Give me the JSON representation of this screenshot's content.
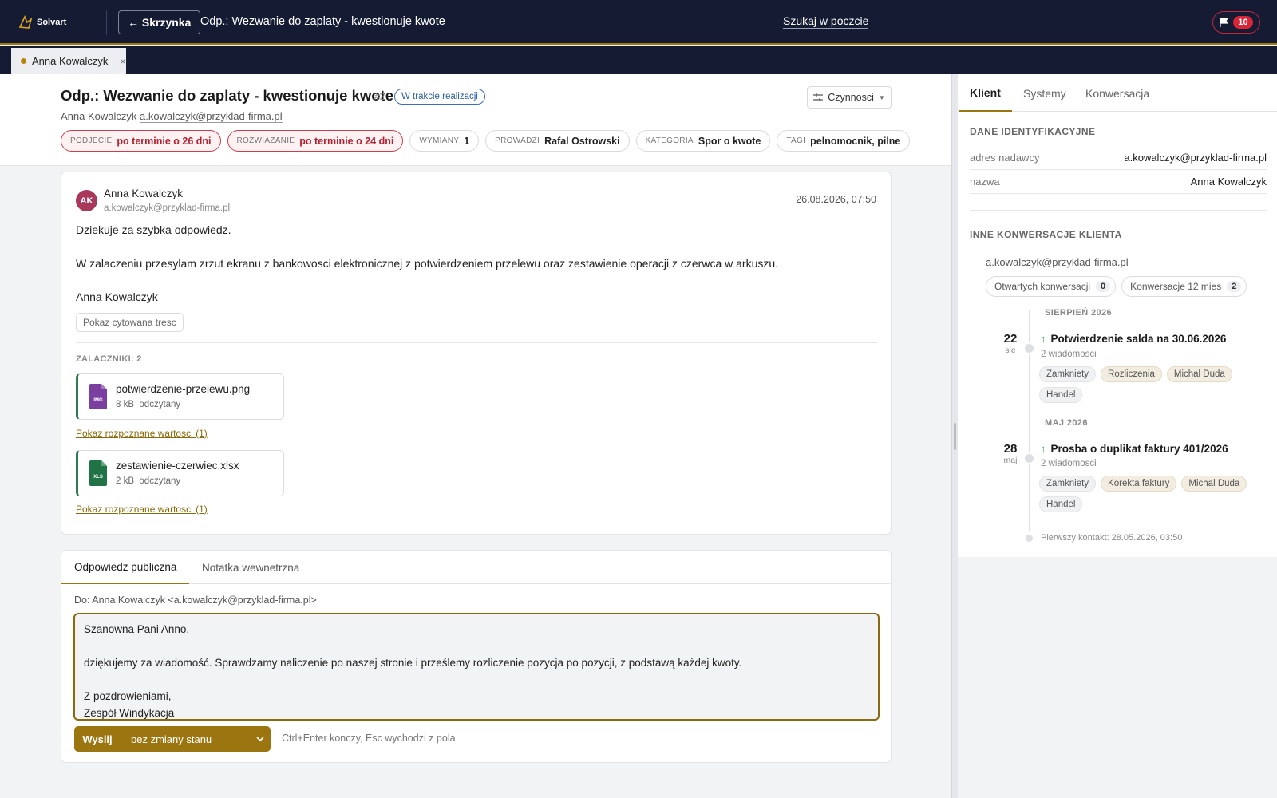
{
  "topbar": {
    "logo_text": "Solvart",
    "back_label": "← Skrzynka",
    "title": "Odp.: Wezwanie do zaplaty - kwestionuje kwote",
    "search_label": "Szukaj w poczcie",
    "flag_count": "10"
  },
  "tabs": {
    "open_tab_label": "Anna Kowalczyk",
    "close_glyph": "×"
  },
  "ticket": {
    "title": "Odp.: Wezwanie do zaplaty - kwestionuje kwote",
    "number": "#2",
    "status": "W trakcie realizacji",
    "actions_label": "Czynnosci",
    "sender_name": "Anna Kowalczyk",
    "sender_email": "a.kowalczyk@przyklad-firma.pl",
    "chips": [
      {
        "key": "PODJECIE",
        "value": "po terminie o 26 dni"
      },
      {
        "key": "ROZWIAZANIE",
        "value": "po terminie o 24 dni"
      },
      {
        "key": "WYMIANY",
        "value": "1"
      },
      {
        "key": "PROWADZI",
        "value": "Rafal Ostrowski"
      },
      {
        "key": "KATEGORIA",
        "value": "Spor o kwote"
      },
      {
        "key": "TAGI",
        "value": "pelnomocnik, pilne"
      }
    ]
  },
  "message": {
    "avatar_initials": "AK",
    "from_name": "Anna Kowalczyk",
    "from_email": "a.kowalczyk@przyklad-firma.pl",
    "date": "26.08.2026, 07:50",
    "body": [
      "Dziekuje za szybka odpowiedz.",
      "W zalaczeniu przesylam zrzut ekranu z bankowosci elektronicznej z potwierdzeniem przelewu oraz zestawienie operacji z czerwca w arkuszu.",
      "Anna Kowalczyk"
    ],
    "show_quote_label": "Pokaz cytowana tresc",
    "attachments_label": "ZALACZNIKI: 2",
    "attachments": [
      {
        "name": "potwierdzenie-przelewu.png",
        "size": "8 kB",
        "status": "odczytany",
        "icon_label": "IMG",
        "icon_color": "#7b3fa0"
      },
      {
        "name": "zestawienie-czerwiec.xlsx",
        "size": "2 kB",
        "status": "odczytany",
        "icon_label": "XLS",
        "icon_color": "#217346"
      }
    ],
    "recognized_link": "Pokaz rozpoznane wartosci (1)"
  },
  "reply": {
    "tab_public": "Odpowiedz publiczna",
    "tab_note": "Notatka wewnetrzna",
    "to_line": "Do: Anna Kowalczyk <a.kowalczyk@przyklad-firma.pl>",
    "text": "Szanowna Pani Anno,\n\ndziękujemy za wiadomość. Sprawdzamy naliczenie po naszej stronie i prześlemy rozliczenie pozycja po pozycji, z podstawą każdej kwoty.\n\nZ pozdrowieniami,\nZespół Windykacja",
    "send_label": "Wyslij",
    "state_label": "bez zmiany stanu",
    "hint": "Ctrl+Enter konczy, Esc wychodzi z pola"
  },
  "sidebar": {
    "tabs": [
      "Klient",
      "Systemy",
      "Konwersacja"
    ],
    "ident_title": "DANE IDENTYFIKACYJNE",
    "rows": [
      {
        "key": "adres nadawcy",
        "value": "a.kowalczyk@przyklad-firma.pl"
      },
      {
        "key": "nazwa",
        "value": "Anna Kowalczyk"
      }
    ],
    "other_title": "INNE KONWERSACJE KLIENTA",
    "client_email": "a.kowalczyk@przyklad-firma.pl",
    "open_label": "Otwartych konwersacji",
    "open_count": "0",
    "year_label": "Konwersacje 12 mies",
    "year_count": "2",
    "timeline": [
      {
        "month": "SIERPIEŃ 2026",
        "day": "22",
        "mon": "sie",
        "title": "Potwierdzenie salda na 30.06.2026",
        "sub": "2 wiadomosci",
        "tags": [
          "Zamkniety",
          "Rozliczenia",
          "Michal Duda",
          "Handel"
        ]
      },
      {
        "month": "MAJ 2026",
        "day": "28",
        "mon": "maj",
        "title": "Prosba o duplikat faktury 401/2026",
        "sub": "2 wiadomosci",
        "tags": [
          "Zamkniety",
          "Korekta faktury",
          "Michal Duda",
          "Handel"
        ]
      }
    ],
    "first_contact": "Pierwszy kontakt: 28.05.2026, 03:50"
  }
}
